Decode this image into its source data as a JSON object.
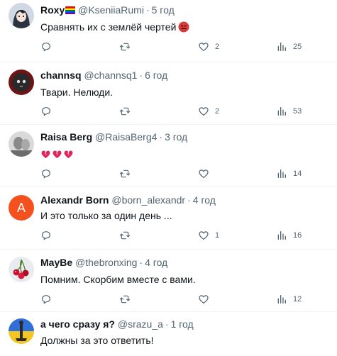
{
  "tweets": [
    {
      "name": "Roxy",
      "handle": "@KseniiaRumi",
      "separator": "·",
      "time": "5 год",
      "text": "Сравнять их с землёй чертей",
      "replies": "",
      "retweets": "",
      "likes": "2",
      "views": "25",
      "avatar_icon": "anime-avatar"
    },
    {
      "name": "channsq",
      "handle": "@channsq1",
      "separator": "·",
      "time": "6 год",
      "text": "Твари. Нелюди.",
      "replies": "",
      "retweets": "",
      "likes": "2",
      "views": "53",
      "avatar_icon": "red-cat-avatar"
    },
    {
      "name": "Raisa Berg",
      "handle": "@RaisaBerg4",
      "separator": "·",
      "time": "3 год",
      "text": "",
      "replies": "",
      "retweets": "",
      "likes": "",
      "views": "14",
      "avatar_icon": "bw-photo-avatar"
    },
    {
      "name": "Alexandr Born",
      "handle": "@born_alexandr",
      "separator": "·",
      "time": "4 год",
      "text": "И это только за один день ...",
      "replies": "",
      "retweets": "",
      "likes": "1",
      "views": "16",
      "avatar_letter": "A",
      "avatar_color": "#f4511e"
    },
    {
      "name": "MayBe",
      "handle": "@thebronxing",
      "separator": "·",
      "time": "4 год",
      "text": "Помним. Скорбим вместе с вами.",
      "replies": "",
      "retweets": "",
      "likes": "",
      "views": "12",
      "avatar_icon": "cherries-avatar"
    },
    {
      "name": "а чего сразу я?",
      "handle": "@srazu_a",
      "separator": "·",
      "time": "1 год",
      "text": "Должны за это ответить!",
      "avatar_icon": "flag-monument-avatar"
    }
  ],
  "colors": {
    "text": "#0f1419",
    "secondary": "#536471",
    "divider": "#eff3f4",
    "heart_broken": "#e0245e"
  }
}
